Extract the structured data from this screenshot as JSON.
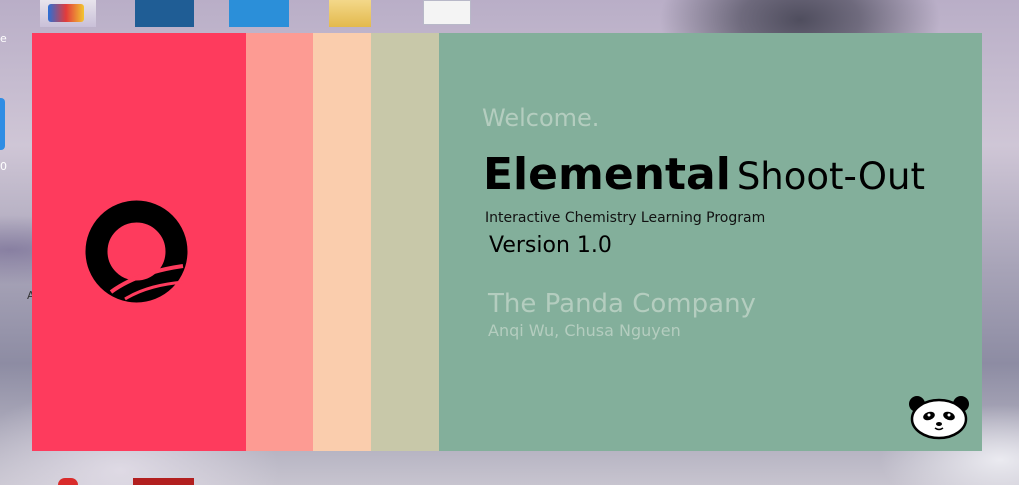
{
  "desktop": {
    "icons": [
      {
        "name": "paint-icon"
      },
      {
        "name": "app-shortcut-icon"
      },
      {
        "name": "app-icon"
      },
      {
        "name": "folder-icon"
      },
      {
        "name": "document-icon"
      }
    ],
    "side_letters": [
      "e",
      "0",
      "A"
    ]
  },
  "splash": {
    "stripe_colors": [
      "#fe3b5d",
      "#fd9b93",
      "#facdad",
      "#c8c8a9",
      "#83af9b"
    ],
    "welcome": "Welcome.",
    "title_bold": "Elemental",
    "title_light": "Shoot-Out",
    "subtitle": "Interactive Chemistry Learning Program",
    "version": "Version 1.0",
    "company": "The Panda Company",
    "authors": "Anqi Wu, Chusa Nguyen",
    "logo_icon": "ring-logo-icon",
    "panda_icon": "panda-icon"
  }
}
